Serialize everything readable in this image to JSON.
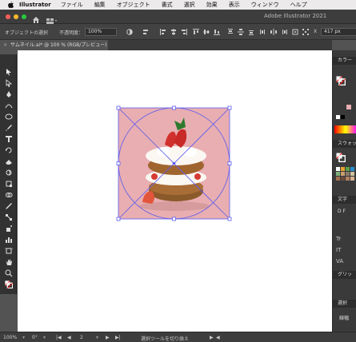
{
  "menubar": {
    "app_name": "Illustrator",
    "items": [
      "ファイル",
      "編集",
      "オブジェクト",
      "書式",
      "選択",
      "効果",
      "表示",
      "ウィンドウ",
      "ヘルプ"
    ]
  },
  "window": {
    "title": "Adobe Illustrator 2021"
  },
  "controlbar": {
    "object_label": "オブジェクトの選択",
    "opacity_label": "不透明度：",
    "opacity_value": "100%",
    "x_label": "X",
    "x_value": "417 px"
  },
  "document_tab": {
    "close": "×",
    "title": "サムネイル.ai* @ 100 % (RGB/プレビュー)"
  },
  "right_panel": {
    "color": "カラー",
    "swatches": "スウォッ",
    "text_header": "文字",
    "font_sample": "D F",
    "glyph": "グリッ",
    "select": "選択",
    "stroke": "線幅"
  },
  "status": {
    "zoom": "100%",
    "rotation": "0°",
    "page": "2",
    "tool_hint": "選択ツールを切り換え"
  },
  "colors": {
    "artboard_bg": "#e8aeb1",
    "selection": "#5b5bf0",
    "close_red": "#fe5f57",
    "minimize_yellow": "#febc2e",
    "zoom_green": "#28c840"
  },
  "artwork": {
    "subject": "strawberry-shortcake-image"
  }
}
